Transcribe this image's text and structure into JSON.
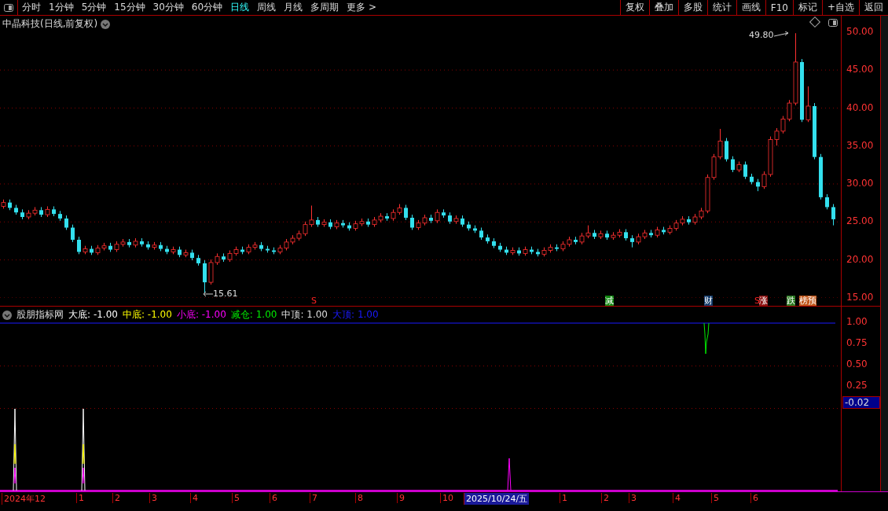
{
  "toolbar": {
    "periods": [
      {
        "label": "分时",
        "selected": false
      },
      {
        "label": "1分钟",
        "selected": false
      },
      {
        "label": "5分钟",
        "selected": false
      },
      {
        "label": "15分钟",
        "selected": false
      },
      {
        "label": "30分钟",
        "selected": false
      },
      {
        "label": "60分钟",
        "selected": false
      },
      {
        "label": "日线",
        "selected": true
      },
      {
        "label": "周线",
        "selected": false
      },
      {
        "label": "月线",
        "selected": false
      },
      {
        "label": "多周期",
        "selected": false
      },
      {
        "label": "更多 >",
        "selected": false
      }
    ],
    "buttons": [
      "复权",
      "叠加",
      "多股",
      "统计",
      "画线",
      "F10",
      "标记",
      "+自选",
      "返回"
    ]
  },
  "chart": {
    "title": "中晶科技(日线,前复权)",
    "high_label": "49.80",
    "low_label": "15.61",
    "price_axis": [
      "50.00",
      "45.00",
      "40.00",
      "35.00",
      "30.00",
      "25.00",
      "20.00",
      "15.00"
    ],
    "chart_data": {
      "type": "candlestick",
      "ohlc": [
        [
          27.0,
          27.9,
          26.7,
          27.5
        ],
        [
          27.5,
          27.9,
          26.5,
          26.8
        ],
        [
          26.8,
          27.2,
          25.9,
          26.2
        ],
        [
          26.2,
          26.6,
          25.3,
          25.6
        ],
        [
          25.6,
          26.5,
          25.3,
          26.1
        ],
        [
          26.1,
          26.9,
          25.8,
          26.5
        ],
        [
          26.5,
          26.9,
          25.6,
          25.9
        ],
        [
          25.9,
          27.0,
          25.6,
          26.6
        ],
        [
          26.6,
          27.0,
          25.7,
          26.0
        ],
        [
          26.0,
          26.4,
          25.1,
          25.4
        ],
        [
          25.4,
          25.8,
          23.9,
          24.2
        ],
        [
          24.2,
          24.6,
          22.3,
          22.6
        ],
        [
          22.6,
          23.0,
          20.7,
          21.0
        ],
        [
          21.0,
          21.8,
          20.7,
          21.4
        ],
        [
          21.4,
          21.8,
          20.6,
          20.9
        ],
        [
          20.9,
          21.9,
          20.6,
          21.5
        ],
        [
          21.5,
          22.2,
          21.2,
          21.8
        ],
        [
          21.8,
          22.2,
          21.0,
          21.3
        ],
        [
          21.3,
          22.4,
          21.0,
          22.0
        ],
        [
          22.0,
          22.7,
          21.7,
          22.3
        ],
        [
          22.3,
          22.7,
          21.6,
          21.9
        ],
        [
          21.9,
          22.8,
          21.6,
          22.4
        ],
        [
          22.4,
          22.8,
          21.7,
          22.0
        ],
        [
          22.0,
          22.4,
          21.3,
          21.6
        ],
        [
          21.6,
          22.3,
          21.3,
          21.9
        ],
        [
          21.9,
          22.3,
          21.1,
          21.4
        ],
        [
          21.4,
          21.8,
          20.7,
          21.0
        ],
        [
          21.0,
          21.7,
          20.7,
          21.3
        ],
        [
          21.3,
          21.7,
          20.3,
          20.6
        ],
        [
          20.6,
          21.3,
          20.3,
          20.9
        ],
        [
          20.9,
          21.3,
          19.9,
          20.2
        ],
        [
          20.2,
          20.6,
          19.2,
          19.5
        ],
        [
          19.5,
          19.9,
          15.61,
          17.0
        ],
        [
          17.0,
          20.0,
          16.7,
          19.6
        ],
        [
          19.6,
          20.8,
          19.3,
          20.4
        ],
        [
          20.4,
          20.8,
          19.7,
          20.0
        ],
        [
          20.0,
          21.2,
          19.7,
          20.8
        ],
        [
          20.8,
          21.7,
          20.5,
          21.3
        ],
        [
          21.3,
          21.7,
          20.7,
          21.0
        ],
        [
          21.0,
          22.0,
          20.7,
          21.6
        ],
        [
          21.6,
          22.3,
          21.3,
          21.9
        ],
        [
          21.9,
          22.3,
          21.1,
          21.4
        ],
        [
          21.4,
          21.8,
          20.9,
          21.2
        ],
        [
          21.2,
          21.6,
          20.7,
          21.0
        ],
        [
          21.0,
          21.9,
          20.7,
          21.5
        ],
        [
          21.5,
          22.7,
          21.2,
          22.3
        ],
        [
          22.3,
          23.2,
          22.0,
          22.8
        ],
        [
          22.8,
          23.8,
          22.5,
          23.4
        ],
        [
          23.4,
          25.0,
          23.1,
          24.6
        ],
        [
          24.6,
          27.1,
          24.3,
          25.2
        ],
        [
          25.2,
          25.6,
          24.3,
          24.6
        ],
        [
          24.6,
          25.3,
          24.3,
          24.9
        ],
        [
          24.9,
          25.3,
          24.0,
          24.3
        ],
        [
          24.3,
          25.2,
          24.0,
          24.8
        ],
        [
          24.8,
          25.2,
          24.2,
          24.5
        ],
        [
          24.5,
          24.9,
          23.8,
          24.1
        ],
        [
          24.1,
          25.1,
          23.8,
          24.7
        ],
        [
          24.7,
          25.4,
          24.4,
          25.0
        ],
        [
          25.0,
          25.4,
          24.3,
          24.6
        ],
        [
          24.6,
          25.6,
          24.3,
          25.2
        ],
        [
          25.2,
          26.1,
          24.9,
          25.7
        ],
        [
          25.7,
          26.1,
          25.1,
          25.4
        ],
        [
          25.4,
          26.6,
          25.1,
          26.2
        ],
        [
          26.2,
          27.3,
          25.9,
          26.8
        ],
        [
          26.8,
          27.2,
          25.2,
          25.5
        ],
        [
          25.5,
          25.9,
          23.9,
          24.2
        ],
        [
          24.2,
          25.2,
          23.9,
          24.8
        ],
        [
          24.8,
          25.9,
          24.5,
          25.5
        ],
        [
          25.5,
          25.9,
          24.8,
          25.1
        ],
        [
          25.1,
          26.6,
          24.8,
          26.2
        ],
        [
          26.2,
          26.6,
          25.5,
          25.8
        ],
        [
          25.8,
          26.2,
          24.7,
          25.0
        ],
        [
          25.0,
          25.8,
          24.7,
          25.4
        ],
        [
          25.4,
          25.8,
          24.3,
          24.6
        ],
        [
          24.6,
          25.0,
          23.8,
          24.1
        ],
        [
          24.1,
          24.5,
          23.5,
          23.8
        ],
        [
          23.8,
          24.2,
          22.6,
          22.9
        ],
        [
          22.9,
          23.3,
          22.1,
          22.4
        ],
        [
          22.4,
          22.8,
          21.5,
          21.8
        ],
        [
          21.8,
          22.2,
          21.0,
          21.3
        ],
        [
          21.3,
          21.7,
          20.6,
          20.9
        ],
        [
          20.9,
          21.6,
          20.6,
          21.2
        ],
        [
          21.2,
          21.6,
          20.5,
          20.8
        ],
        [
          20.8,
          21.7,
          20.5,
          21.3
        ],
        [
          21.3,
          21.7,
          20.7,
          21.0
        ],
        [
          21.0,
          21.4,
          20.4,
          20.7
        ],
        [
          20.7,
          21.6,
          20.4,
          21.2
        ],
        [
          21.2,
          22.0,
          20.9,
          21.6
        ],
        [
          21.6,
          22.0,
          21.1,
          21.4
        ],
        [
          21.4,
          22.4,
          21.1,
          22.0
        ],
        [
          22.0,
          23.0,
          21.7,
          22.6
        ],
        [
          22.6,
          23.0,
          22.0,
          22.3
        ],
        [
          22.3,
          23.5,
          22.0,
          23.1
        ],
        [
          23.1,
          24.5,
          22.8,
          23.5
        ],
        [
          23.5,
          23.9,
          22.7,
          23.0
        ],
        [
          23.0,
          23.8,
          22.7,
          23.4
        ],
        [
          23.4,
          23.8,
          22.6,
          22.9
        ],
        [
          22.9,
          23.6,
          22.6,
          23.2
        ],
        [
          23.2,
          24.0,
          22.9,
          23.6
        ],
        [
          23.6,
          24.0,
          22.5,
          22.8
        ],
        [
          22.8,
          23.2,
          21.6,
          22.3
        ],
        [
          22.3,
          23.4,
          22.0,
          23.0
        ],
        [
          23.0,
          23.9,
          22.7,
          23.5
        ],
        [
          23.5,
          23.9,
          22.9,
          23.2
        ],
        [
          23.2,
          24.3,
          22.9,
          23.9
        ],
        [
          23.9,
          24.3,
          23.3,
          23.6
        ],
        [
          23.6,
          24.5,
          23.3,
          24.1
        ],
        [
          24.1,
          25.2,
          23.8,
          24.8
        ],
        [
          24.8,
          25.7,
          24.5,
          25.3
        ],
        [
          25.3,
          25.7,
          24.6,
          24.9
        ],
        [
          24.9,
          26.0,
          24.6,
          25.6
        ],
        [
          25.6,
          26.8,
          25.3,
          26.4
        ],
        [
          26.4,
          31.2,
          26.1,
          30.8
        ],
        [
          30.8,
          33.9,
          30.5,
          33.5
        ],
        [
          33.5,
          37.2,
          33.2,
          35.6
        ],
        [
          35.6,
          36.0,
          32.9,
          33.2
        ],
        [
          33.2,
          33.6,
          31.5,
          31.8
        ],
        [
          31.8,
          32.9,
          31.5,
          32.5
        ],
        [
          32.5,
          32.9,
          30.6,
          30.9
        ],
        [
          30.9,
          31.3,
          29.9,
          30.2
        ],
        [
          30.2,
          30.6,
          29.0,
          29.6
        ],
        [
          29.6,
          31.6,
          29.3,
          31.2
        ],
        [
          31.2,
          36.2,
          30.9,
          35.8
        ],
        [
          35.8,
          37.3,
          35.0,
          36.9
        ],
        [
          36.9,
          38.9,
          36.6,
          38.5
        ],
        [
          38.5,
          41.0,
          38.2,
          40.6
        ],
        [
          40.6,
          49.8,
          40.3,
          46.0
        ],
        [
          46.0,
          46.4,
          38.1,
          38.4
        ],
        [
          38.4,
          42.8,
          38.1,
          40.2
        ],
        [
          40.2,
          40.6,
          33.2,
          33.5
        ],
        [
          33.5,
          33.9,
          27.9,
          28.2
        ],
        [
          28.2,
          28.6,
          26.6,
          26.9
        ],
        [
          26.9,
          27.3,
          24.5,
          25.3
        ]
      ]
    },
    "markers": [
      {
        "text": "S",
        "color": "#000000"
      },
      {
        "text": "减",
        "color": "#118811"
      },
      {
        "text": "财",
        "color": "#113a6a"
      },
      {
        "text": "S",
        "color": "#000000"
      },
      {
        "text": "涨",
        "color": "#8a1010"
      },
      {
        "text": "跌",
        "color": "#2a7a20"
      },
      {
        "text": "榜预",
        "color": "#c0561a"
      }
    ]
  },
  "indicator": {
    "name": "股朋指标网",
    "legend": [
      {
        "label": "大底:",
        "value": "-1.00",
        "color": "#ffffff"
      },
      {
        "label": "中底:",
        "value": "-1.00",
        "color": "#ffff00"
      },
      {
        "label": "小底:",
        "value": "-1.00",
        "color": "#ff00ff"
      },
      {
        "label": "减仓:",
        "value": "1.00",
        "color": "#00ee00"
      },
      {
        "label": "中顶:",
        "value": "1.00",
        "color": "#dddddd"
      },
      {
        "label": "大顶:",
        "value": "1.00",
        "color": "#1a1aff"
      }
    ],
    "axis": [
      "1.00",
      "0.75",
      "0.50",
      "0.25"
    ],
    "current": "-0.02"
  },
  "time_axis": [
    {
      "label": "2024年12",
      "selected": false
    },
    {
      "label": "1",
      "selected": false
    },
    {
      "label": "2",
      "selected": false
    },
    {
      "label": "3",
      "selected": false
    },
    {
      "label": "4",
      "selected": false
    },
    {
      "label": "5",
      "selected": false
    },
    {
      "label": "6",
      "selected": false
    },
    {
      "label": "7",
      "selected": false
    },
    {
      "label": "8",
      "selected": false
    },
    {
      "label": "9",
      "selected": false
    },
    {
      "label": "10",
      "selected": false
    },
    {
      "label": "2025/10/24/五",
      "selected": true
    },
    {
      "label": "1",
      "selected": false
    },
    {
      "label": "2",
      "selected": false
    },
    {
      "label": "3",
      "selected": false
    },
    {
      "label": "4",
      "selected": false
    },
    {
      "label": "5",
      "selected": false
    },
    {
      "label": "6",
      "selected": false
    }
  ]
}
